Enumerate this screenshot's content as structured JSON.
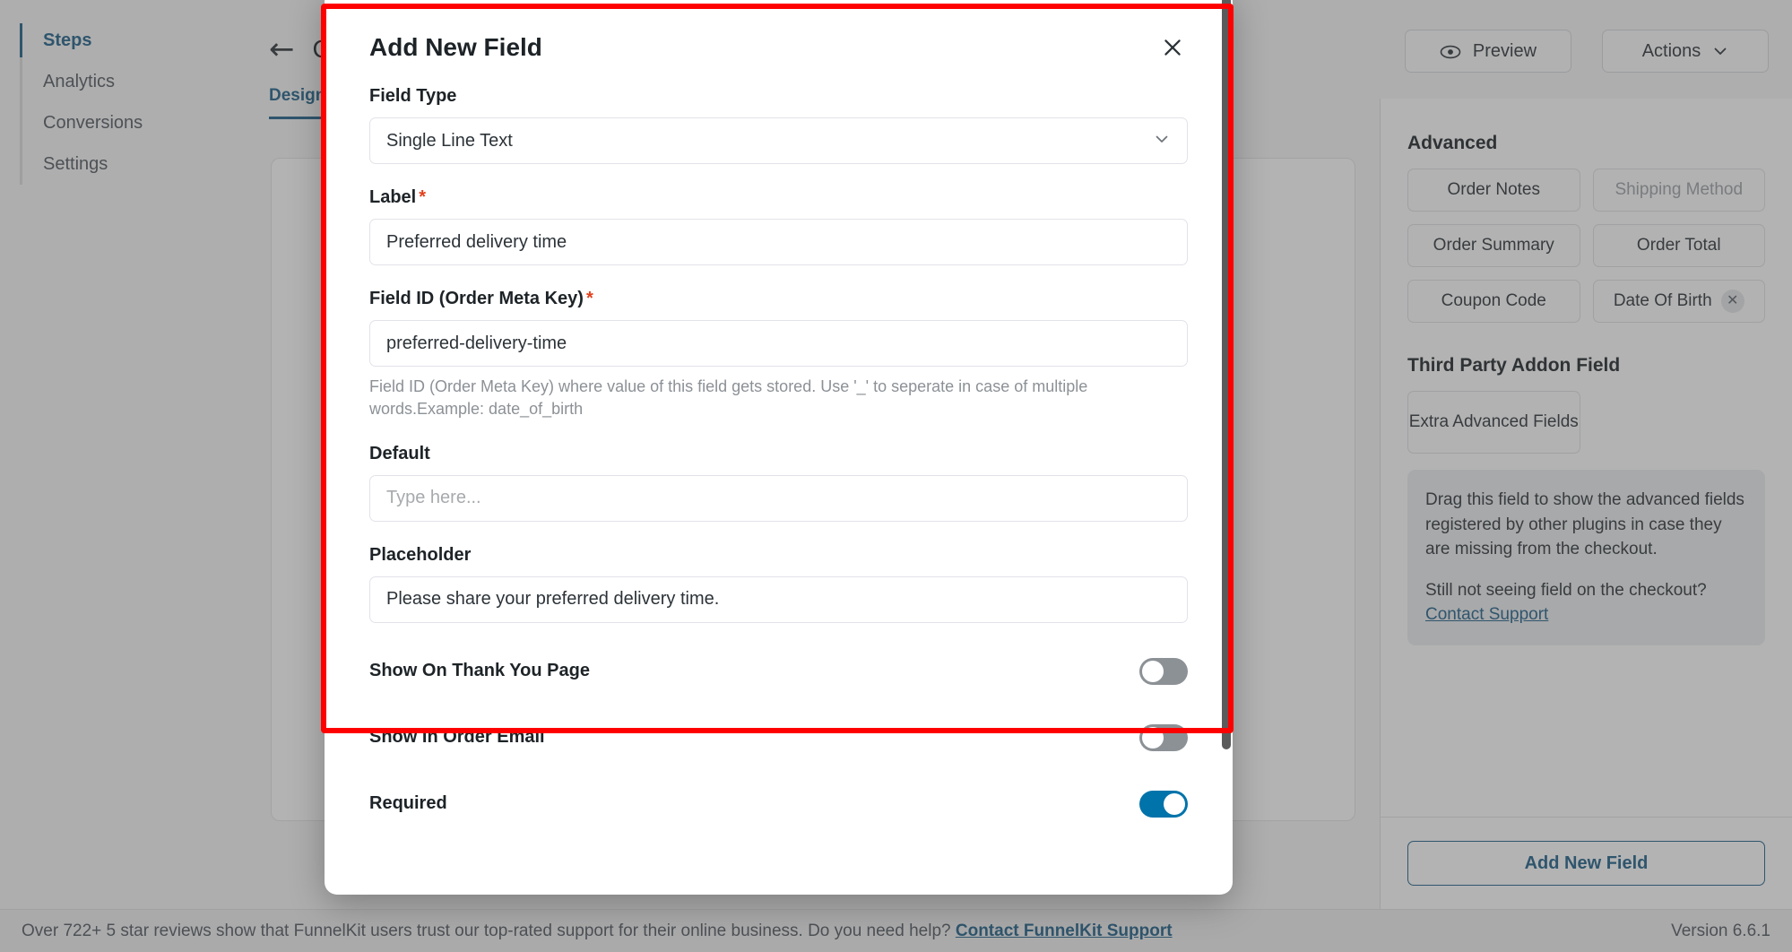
{
  "sidebar": {
    "items": [
      {
        "label": "Steps",
        "active": true
      },
      {
        "label": "Analytics",
        "active": false
      },
      {
        "label": "Conversions",
        "active": false
      },
      {
        "label": "Settings",
        "active": false
      }
    ]
  },
  "editor": {
    "back_icon": "arrow-left-icon",
    "title": "C",
    "tabs": [
      {
        "label": "Design",
        "active": true
      }
    ]
  },
  "header": {
    "preview_label": "Preview",
    "preview_icon": "eye-icon",
    "actions_label": "Actions",
    "actions_icon": "chevron-down-icon"
  },
  "right_panel": {
    "advanced_heading": "Advanced",
    "advanced_chips": [
      {
        "label": "Order Notes",
        "muted": false,
        "removable": false
      },
      {
        "label": "Shipping Method",
        "muted": true,
        "removable": false
      },
      {
        "label": "Order Summary",
        "muted": false,
        "removable": false
      },
      {
        "label": "Order Total",
        "muted": false,
        "removable": false
      },
      {
        "label": "Coupon Code",
        "muted": false,
        "removable": false
      },
      {
        "label": "Date Of Birth",
        "muted": false,
        "removable": true
      }
    ],
    "third_party_heading": "Third Party Addon Field",
    "third_party_chip": "Extra Advanced Fields",
    "note_line_1": "Drag this field to show the advanced fields registered by other plugins in case they are missing from the checkout.",
    "note_line_2_prefix": "Still not seeing field on the checkout?",
    "note_link": " Contact Support",
    "add_new_field_label": "Add New Field"
  },
  "modal": {
    "title": "Add New Field",
    "close_icon": "close-icon",
    "field_type": {
      "label": "Field Type",
      "value": "Single Line Text",
      "chevron_icon": "chevron-down-icon"
    },
    "label_field": {
      "label": "Label",
      "required_mark": "*",
      "value": "Preferred delivery time"
    },
    "field_id": {
      "label": "Field ID (Order Meta Key)",
      "required_mark": "*",
      "value": "preferred-delivery-time",
      "help": "Field ID (Order Meta Key) where value of this field gets stored. Use '_' to seperate in case of multiple words.Example: date_of_birth"
    },
    "default_field": {
      "label": "Default",
      "value": "",
      "placeholder": "Type here..."
    },
    "placeholder_field": {
      "label": "Placeholder",
      "value": "Please share your preferred delivery time."
    },
    "toggles": [
      {
        "label": "Show On Thank You Page",
        "on": false
      },
      {
        "label": "Show In Order Email",
        "on": false
      },
      {
        "label": "Required",
        "on": true
      }
    ]
  },
  "footer": {
    "text": "Over 722+ 5 star reviews show that FunnelKit users trust our top-rated support for their online business. Do you need help?",
    "link": "Contact FunnelKit Support",
    "version": "Version 6.6.1"
  },
  "annotation": {
    "color": "#ff0000"
  }
}
